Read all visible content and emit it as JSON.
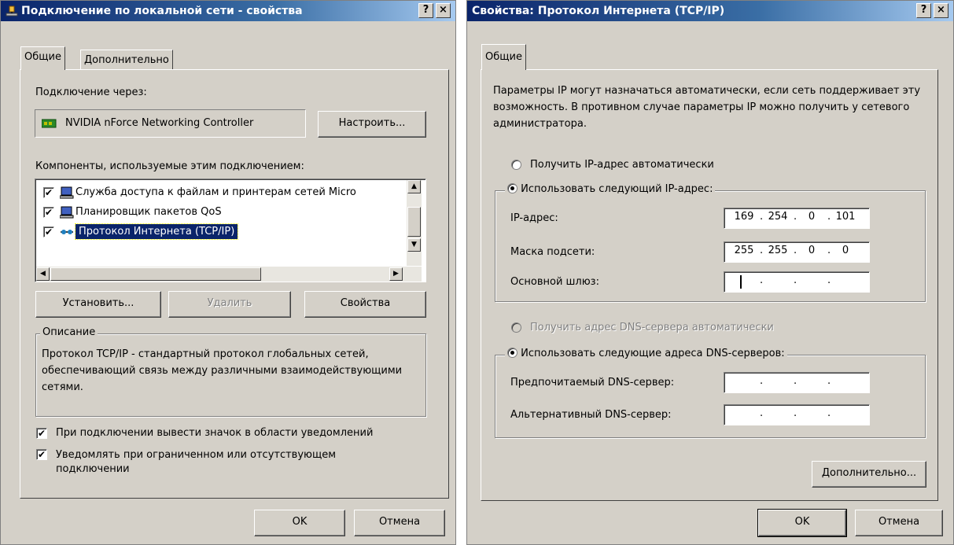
{
  "left": {
    "title": "Подключение по локальной сети - свойства",
    "help_btn": "?",
    "close_btn": "×",
    "tabs": [
      "Общие",
      "Дополнительно"
    ],
    "connect_via_label": "Подключение через:",
    "adapter_name": "NVIDIA nForce Networking Controller",
    "configure_btn": "Настроить...",
    "components_label": "Компоненты, используемые этим подключением:",
    "components": [
      {
        "label": "Служба доступа к файлам и принтерам сетей Micro",
        "checked": true
      },
      {
        "label": "Планировщик пакетов QoS",
        "checked": true
      },
      {
        "label": "Протокол Интернета (TCP/IP)",
        "checked": true
      }
    ],
    "install_btn": "Установить...",
    "remove_btn": "Удалить",
    "properties_btn": "Свойства",
    "description_title": "Описание",
    "description_text": "Протокол TCP/IP - стандартный протокол глобальных сетей, обеспечивающий связь между различными взаимодействующими сетями.",
    "show_icon_label": "При подключении вывести значок в области уведомлений",
    "notify_label": "Уведомлять при ограниченном или отсутствующем подключении",
    "ok_btn": "OK",
    "cancel_btn": "Отмена"
  },
  "right": {
    "title": "Свойства: Протокол Интернета (TCP/IP)",
    "help_btn": "?",
    "close_btn": "×",
    "tab": "Общие",
    "info_text": "Параметры IP могут назначаться автоматически, если сеть поддерживает эту возможность. В противном случае параметры IP можно получить у сетевого администратора.",
    "auto_ip_label": "Получить IP-адрес автоматически",
    "manual_ip_label": "Использовать следующий IP-адрес:",
    "ip_label": "IP-адрес:",
    "ip_value": [
      "169",
      "254",
      "0",
      "101"
    ],
    "mask_label": "Маска подсети:",
    "mask_value": [
      "255",
      "255",
      "0",
      "0"
    ],
    "gateway_label": "Основной шлюз:",
    "auto_dns_label": "Получить адрес DNS-сервера автоматически",
    "manual_dns_label": "Использовать следующие адреса DNS-серверов:",
    "preferred_dns_label": "Предпочитаемый DNS-сервер:",
    "alternate_dns_label": "Альтернативный DNS-сервер:",
    "advanced_btn": "Дополнительно...",
    "ok_btn": "OK",
    "cancel_btn": "Отмена"
  },
  "colors": {
    "dialog_bg": "#d4d0c8",
    "title_start": "#0a246a",
    "title_end": "#a6caf0",
    "selection": "#0a246a"
  },
  "icons": [
    "network-connection-icon",
    "network-card-icon",
    "computer-icon",
    "protocol-icon"
  ]
}
